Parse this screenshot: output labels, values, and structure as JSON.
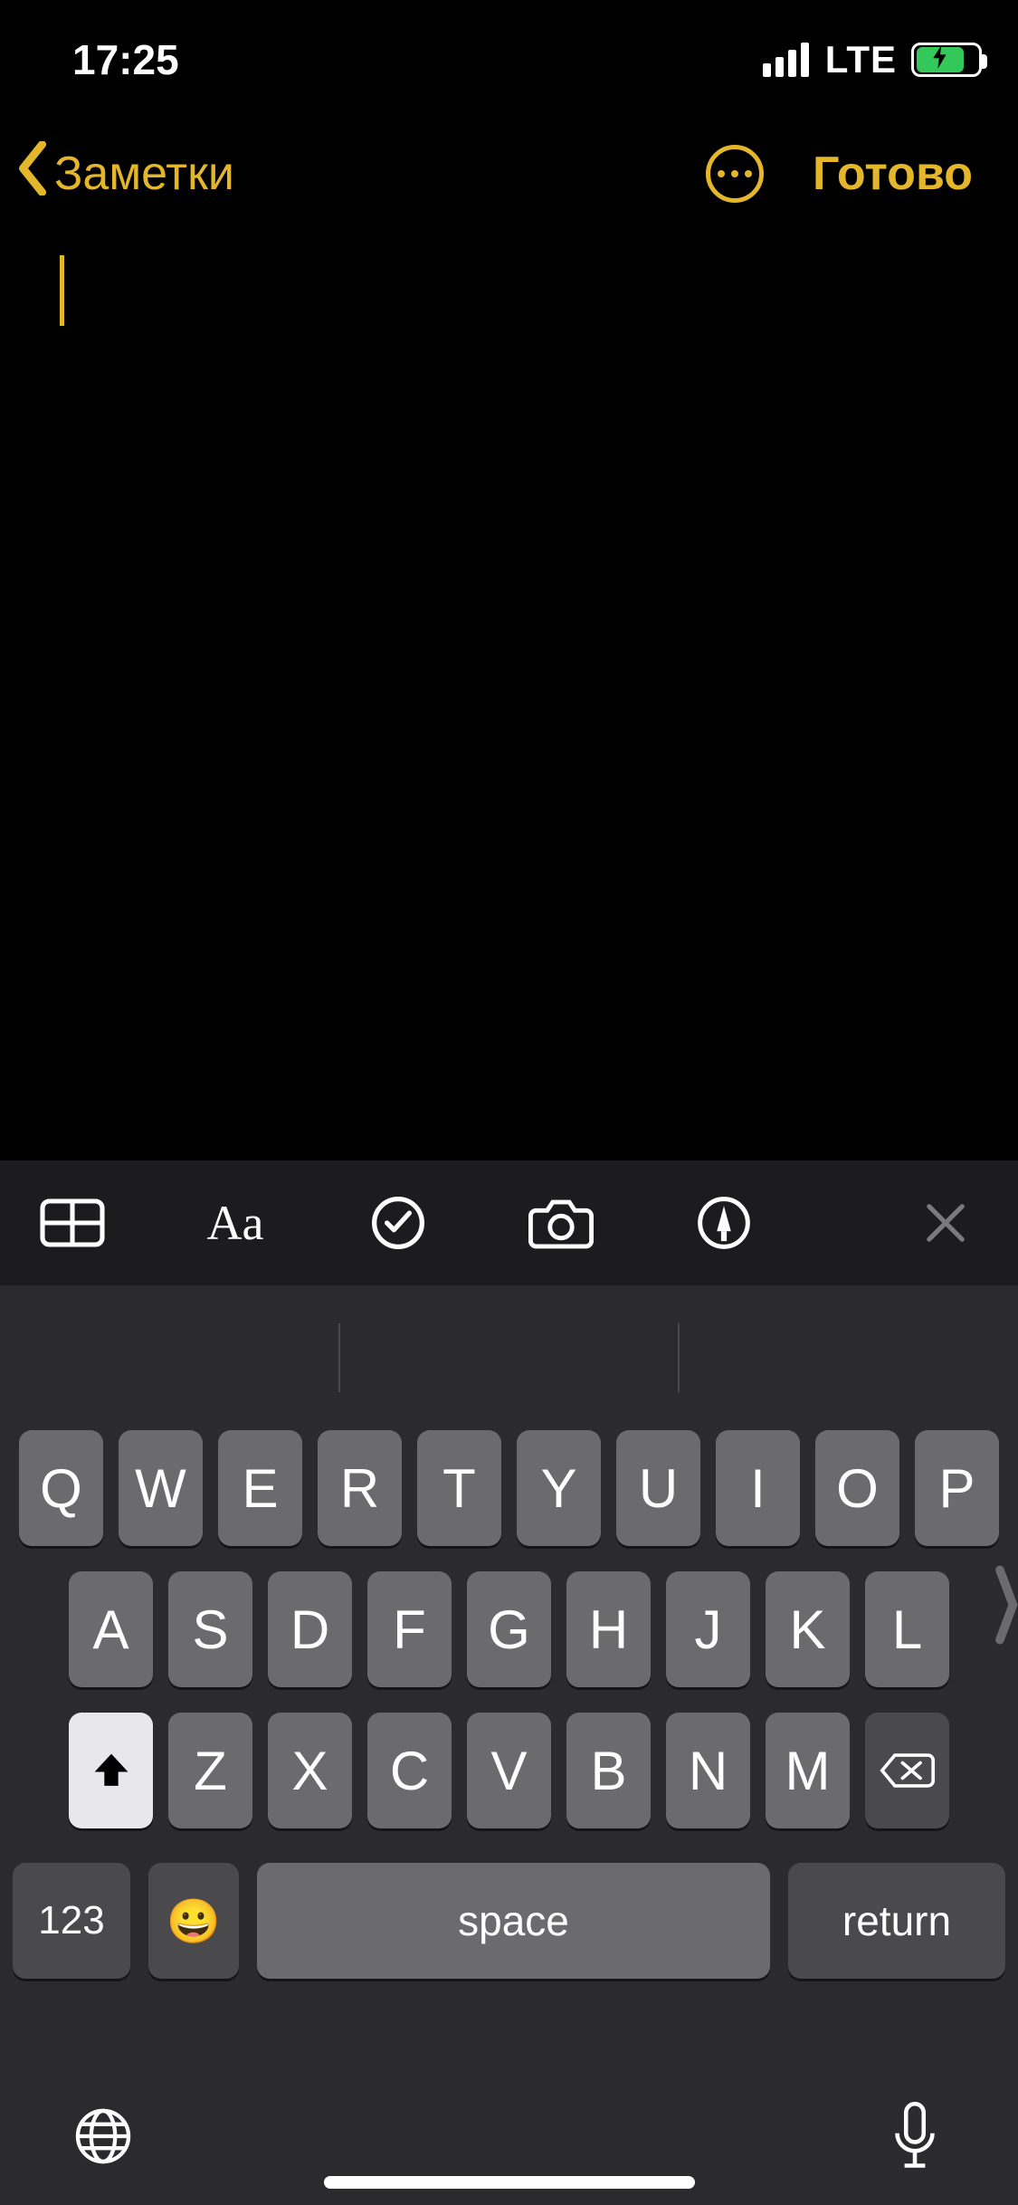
{
  "status": {
    "time": "17:25",
    "network": "LTE"
  },
  "nav": {
    "back_label": "Заметки",
    "done_label": "Готово"
  },
  "format_bar": {
    "aa": "Aa"
  },
  "keyboard": {
    "row1": [
      "Q",
      "W",
      "E",
      "R",
      "T",
      "Y",
      "U",
      "I",
      "O",
      "P"
    ],
    "row2": [
      "A",
      "S",
      "D",
      "F",
      "G",
      "H",
      "J",
      "K",
      "L"
    ],
    "row3": [
      "Z",
      "X",
      "C",
      "V",
      "B",
      "N",
      "M"
    ],
    "numeric_label": "123",
    "space_label": "space",
    "return_label": "return"
  }
}
